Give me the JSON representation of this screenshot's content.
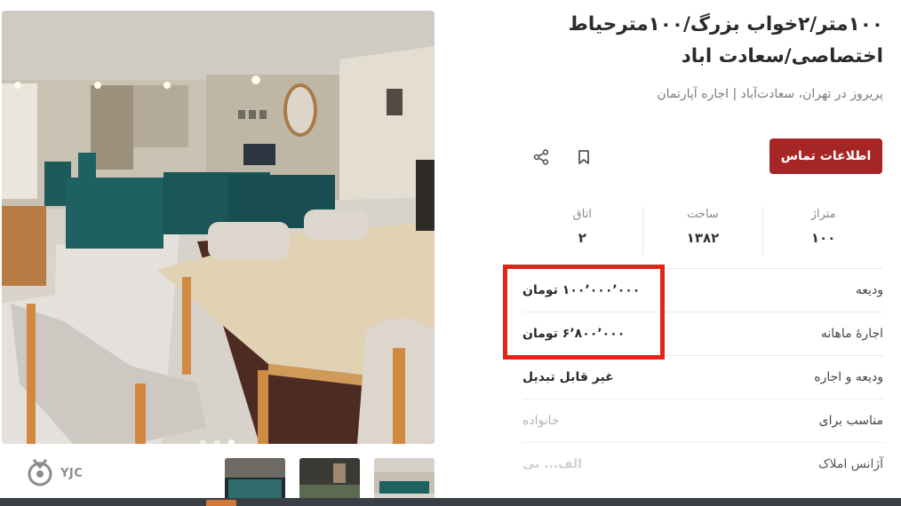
{
  "listing": {
    "title": "۱۰۰متر/۲خواب بزرگ/۱۰۰مترحیاط اختصاصی/سعادت اباد",
    "subtitle": "پریروز در تهران، سعادت‌آباد | اجاره آپارتمان"
  },
  "actions": {
    "contact_label": "اطلاعات تماس",
    "bookmark_icon": "bookmark-icon",
    "share_icon": "share-icon"
  },
  "stats": [
    {
      "label": "متراژ",
      "value": "۱۰۰"
    },
    {
      "label": "ساخت",
      "value": "۱۳۸۲"
    },
    {
      "label": "اتاق",
      "value": "۲"
    }
  ],
  "details": [
    {
      "label": "ودیعه",
      "value": "۱۰۰٬۰۰۰٬۰۰۰ تومان"
    },
    {
      "label": "اجارهٔ ماهانه",
      "value": "۶٬۸۰۰٬۰۰۰ تومان"
    },
    {
      "label": "ودیعه و اجاره",
      "value": "غیر قابل تبدیل"
    },
    {
      "label": "مناسب برای",
      "value": "خانواده"
    },
    {
      "label": "آژانس املاک",
      "value": "الف... بی"
    }
  ],
  "gallery": {
    "photo_count": 3,
    "active_photo": 3,
    "thumbnail_count": 3
  },
  "watermark": {
    "text": "YJC"
  },
  "colors": {
    "primary": "#a62626",
    "highlight": "#e1251b"
  }
}
